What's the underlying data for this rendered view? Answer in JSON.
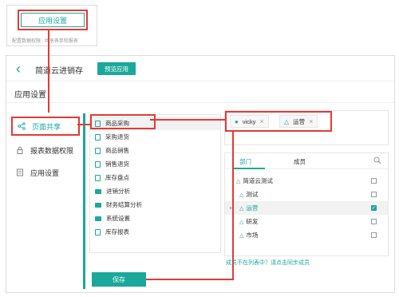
{
  "config_card": {
    "button_label": "应用设置",
    "hint_left": "配置数据权限",
    "hint_right": "共享表单和报表"
  },
  "header": {
    "back_icon": "chevron-left-icon",
    "app_name": "简道云进销存",
    "preview_label": "预览应用"
  },
  "section_title": "应用设置",
  "sidebar": {
    "items": [
      {
        "label": "页面共享",
        "icon": "share-icon",
        "active": true
      },
      {
        "label": "报表数据权限",
        "icon": "lock-icon",
        "active": false
      },
      {
        "label": "应用设置",
        "icon": "settings-icon",
        "active": false
      }
    ]
  },
  "reports": {
    "items": [
      {
        "label": "商品采购",
        "type": "form"
      },
      {
        "label": "采购退货",
        "type": "form"
      },
      {
        "label": "商品销售",
        "type": "form"
      },
      {
        "label": "销售退货",
        "type": "form"
      },
      {
        "label": "库存盘点",
        "type": "form"
      },
      {
        "label": "进销分析",
        "type": "folder"
      },
      {
        "label": "财务结算分析",
        "type": "folder"
      },
      {
        "label": "系统设置",
        "type": "folder"
      },
      {
        "label": "库存报表",
        "type": "report"
      }
    ]
  },
  "selected_members": [
    {
      "label": "vicky",
      "icon": "user-icon"
    },
    {
      "label": "运营",
      "icon": "department-icon"
    }
  ],
  "picker": {
    "tabs": [
      "部门",
      "成员"
    ],
    "active_tab": "部门",
    "tree": [
      {
        "label": "简道云测试",
        "level": 0,
        "checked": false
      },
      {
        "label": "测试",
        "level": 1,
        "checked": false
      },
      {
        "label": "运营",
        "level": 1,
        "checked": true,
        "expandable": true
      },
      {
        "label": "研发",
        "level": 1,
        "checked": false
      },
      {
        "label": "市场",
        "level": 1,
        "checked": false
      }
    ],
    "sync_hint": "成员不在列表中？请点击同步成员"
  },
  "save_label": "保存",
  "colors": {
    "accent": "#1aa89b",
    "annotation": "#e53935"
  }
}
